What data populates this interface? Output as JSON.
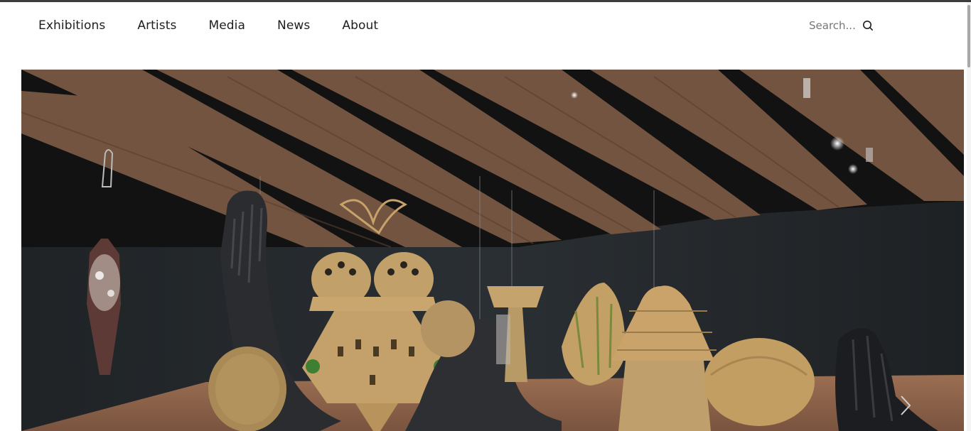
{
  "nav": {
    "items": [
      {
        "label": "Exhibitions"
      },
      {
        "label": "Artists"
      },
      {
        "label": "Media"
      },
      {
        "label": "News"
      },
      {
        "label": "About"
      }
    ]
  },
  "search": {
    "placeholder": "Search...",
    "icon": "search-icon"
  },
  "hero": {
    "content": "gallery installation photo of woven fiber sculptures",
    "next_icon": "chevron-right-icon"
  },
  "colors": {
    "text": "#1e1e1e",
    "placeholder": "#777777",
    "topline": "#3c3c3c",
    "wall": "#24282b",
    "ceiling": "#6b4e3a",
    "fiber": "#c7a26a",
    "black_fiber": "#2b2b2e",
    "floor": "#8a6248"
  }
}
